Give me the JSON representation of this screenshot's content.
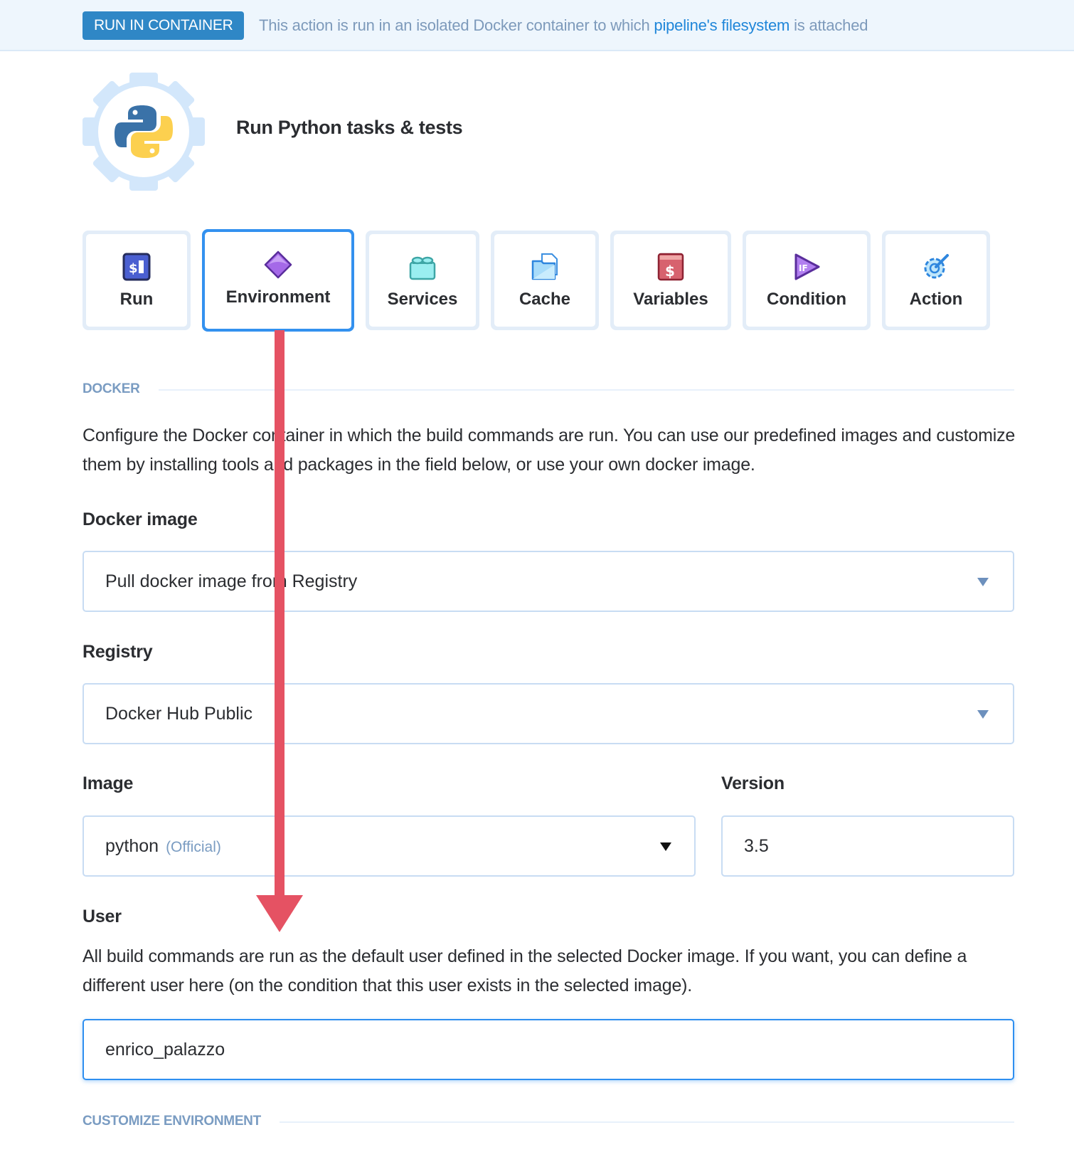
{
  "banner": {
    "badge": "RUN IN CONTAINER",
    "text_before": "This action is run in an isolated Docker container to which ",
    "link": "pipeline's filesystem",
    "text_after": " is attached"
  },
  "action": {
    "title": "Run Python tasks & tests",
    "logo_icon": "python-gear-icon"
  },
  "tabs": [
    {
      "label": "Run",
      "icon": "terminal-dollar-icon",
      "active": false
    },
    {
      "label": "Environment",
      "icon": "diamond-icon",
      "active": true
    },
    {
      "label": "Services",
      "icon": "lego-brick-icon",
      "active": false
    },
    {
      "label": "Cache",
      "icon": "folder-file-icon",
      "active": false
    },
    {
      "label": "Variables",
      "icon": "dollar-box-icon",
      "active": false
    },
    {
      "label": "Condition",
      "icon": "if-play-icon",
      "active": false
    },
    {
      "label": "Action",
      "icon": "gear-wrench-icon",
      "active": false
    }
  ],
  "docker_section": {
    "title": "DOCKER",
    "description": "Configure the Docker container in which the build commands are run. You can use our predefined images and customize them by installing tools and packages in the field below, or use your own docker image."
  },
  "fields": {
    "docker_image": {
      "label": "Docker image",
      "value": "Pull docker image from Registry"
    },
    "registry": {
      "label": "Registry",
      "value": "Docker Hub Public"
    },
    "image": {
      "label": "Image",
      "value": "python",
      "tag": "(Official)"
    },
    "version": {
      "label": "Version",
      "value": "3.5"
    },
    "user": {
      "label": "User",
      "description": "All build commands are run as the default user defined in the selected Docker image. If you want, you can define a different user here (on the condition that this user exists in the selected image).",
      "value": "enrico_palazzo"
    }
  },
  "customize_section": {
    "title": "CUSTOMIZE ENVIRONMENT"
  },
  "colors": {
    "accent": "#3391ef",
    "badge": "#2f87c6",
    "annotation_arrow": "#e55263",
    "muted": "#7a9cc2"
  }
}
